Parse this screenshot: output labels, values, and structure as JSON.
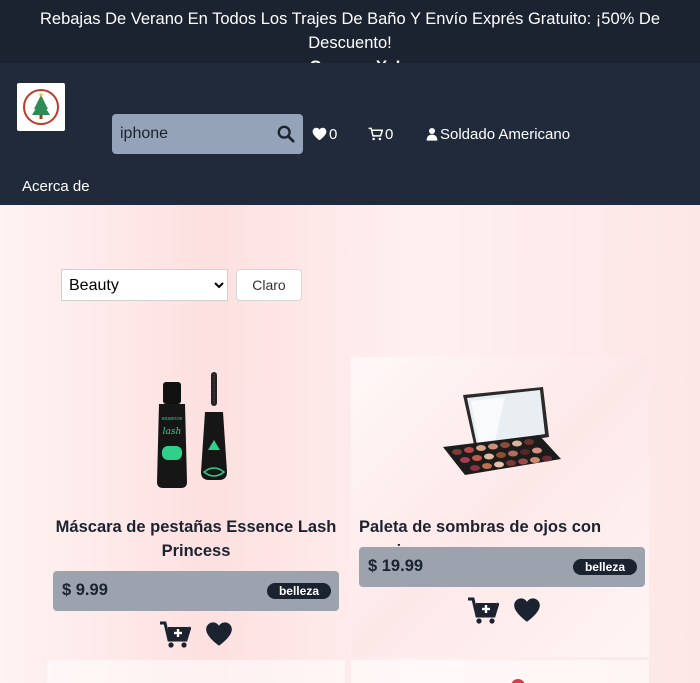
{
  "promo": {
    "text": "Rebajas De Verano En Todos Los Trajes De Baño Y Envío Exprés Gratuito: ¡50% De Descuento!",
    "prefix": "¡ ",
    "link": "Compra Ya!"
  },
  "nav": {
    "search_value": "iphone",
    "wishlist_count": "0",
    "cart_count": "0",
    "user_name": "Soldado Americano",
    "about": "Acerca de"
  },
  "filter": {
    "selected": "Beauty",
    "clear_label": "Claro"
  },
  "products": [
    {
      "title": "Máscara de pestañas Essence Lash Princess",
      "price": "$ 9.99",
      "category": "belleza"
    },
    {
      "title": "Paleta de sombras de ojos con espejo",
      "price": "$ 19.99",
      "category": "belleza"
    }
  ],
  "colors": {
    "header_bg": "#212a3b",
    "promo_bg": "#1b2230",
    "price_bar": "#9ca3af"
  }
}
